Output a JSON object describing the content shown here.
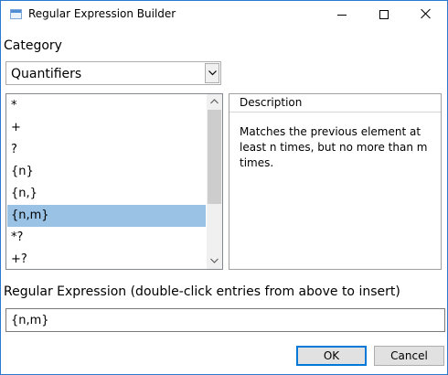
{
  "window": {
    "title": "Regular Expression Builder",
    "controls": [
      "minimize-icon",
      "maximize-icon",
      "close-icon"
    ]
  },
  "category": {
    "label": "Category",
    "selected": "Quantifiers"
  },
  "entries": {
    "items": [
      "*",
      "+",
      "?",
      "{n}",
      "{n,}",
      "{n,m}",
      "*?",
      "+?"
    ],
    "selected_index": 5
  },
  "description": {
    "header": "Description",
    "text": "Matches the previous element at least n times, but no more than m times."
  },
  "regex": {
    "label": "Regular Expression (double-click entries from above to insert)",
    "value": "{n,m}"
  },
  "buttons": {
    "ok": "OK",
    "cancel": "Cancel"
  },
  "colors": {
    "selection": "#99c2e5",
    "window_border": "#2b79d0",
    "default_button_border": "#0078d7"
  }
}
